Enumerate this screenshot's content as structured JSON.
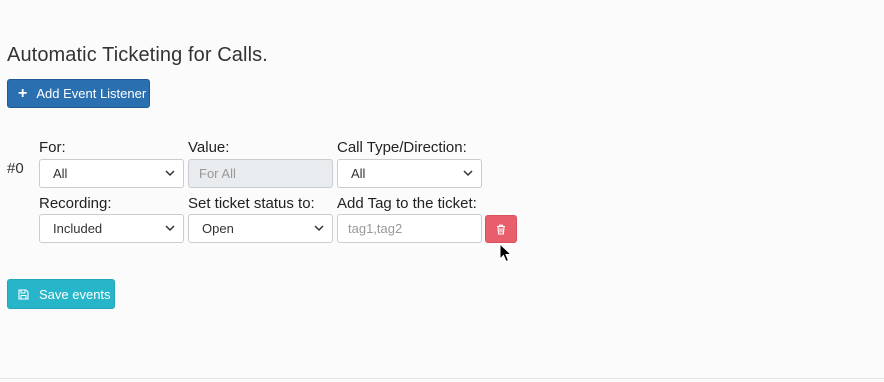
{
  "page": {
    "title": "Automatic Ticketing for Calls."
  },
  "toolbar": {
    "add_label": "Add Event Listener"
  },
  "event": {
    "index_label": "#0",
    "for": {
      "label": "For:",
      "value": "All"
    },
    "value": {
      "label": "Value:",
      "placeholder": "For All"
    },
    "call_type": {
      "label": "Call Type/Direction:",
      "value": "All"
    },
    "recording": {
      "label": "Recording:",
      "value": "Included"
    },
    "status": {
      "label": "Set ticket status to:",
      "value": "Open"
    },
    "tags": {
      "label": "Add Tag to the ticket:",
      "placeholder": "tag1,tag2"
    }
  },
  "footer": {
    "save_label": "Save events"
  },
  "colors": {
    "primary": "#2a6fb0",
    "danger": "#e85e6c",
    "info": "#27b5c9"
  },
  "icons": {
    "add": "plus-icon",
    "delete": "trash-icon",
    "save": "floppy-disk-icon",
    "cursor": "mouse-pointer-icon"
  }
}
